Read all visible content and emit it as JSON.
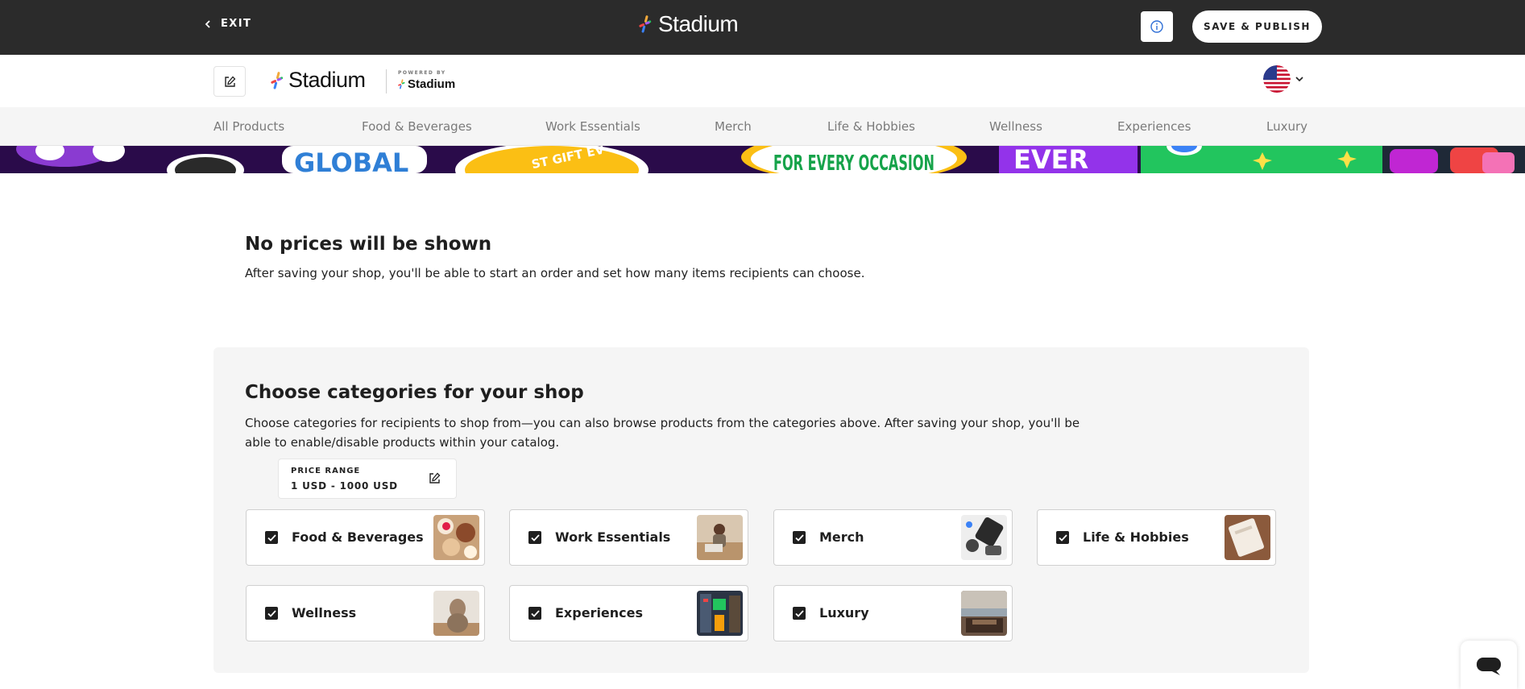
{
  "topbar": {
    "exit_label": "EXIT",
    "brand": "Stadium",
    "publish_label": "SAVE & PUBLISH"
  },
  "shop_header": {
    "logo_text": "Stadium",
    "powered_by": "POWERED BY",
    "powered_brand": "Stadium"
  },
  "nav": {
    "items": [
      {
        "label": "All Products"
      },
      {
        "label": "Food & Beverages"
      },
      {
        "label": "Work Essentials"
      },
      {
        "label": "Merch"
      },
      {
        "label": "Life & Hobbies"
      },
      {
        "label": "Wellness"
      },
      {
        "label": "Experiences"
      },
      {
        "label": "Luxury"
      }
    ]
  },
  "banner": {
    "texts": [
      "GLOBAL",
      "ST GIFT EV",
      "FOR EVERY OCCASION",
      "EVER"
    ]
  },
  "no_prices": {
    "title": "No prices will be shown",
    "text": "After saving your shop, you'll be able to start an order and set how many items recipients can choose."
  },
  "categories": {
    "title": "Choose categories for your shop",
    "description": "Choose categories for recipients to shop from—you can also browse products from the categories above. After saving your shop, you'll be able to enable/disable products within your catalog.",
    "price_range_label": "PRICE RANGE",
    "price_range_value": "1 USD - 1000 USD",
    "cards": [
      {
        "label": "Food & Beverages",
        "checked": true
      },
      {
        "label": "Work Essentials",
        "checked": true
      },
      {
        "label": "Merch",
        "checked": true
      },
      {
        "label": "Life & Hobbies",
        "checked": true
      },
      {
        "label": "Wellness",
        "checked": true
      },
      {
        "label": "Experiences",
        "checked": true
      },
      {
        "label": "Luxury",
        "checked": true
      }
    ]
  },
  "colors": {
    "topbar_bg": "#2b2b2b",
    "panel_bg": "#f5f5f5",
    "accent_info": "#2f6fd6"
  }
}
